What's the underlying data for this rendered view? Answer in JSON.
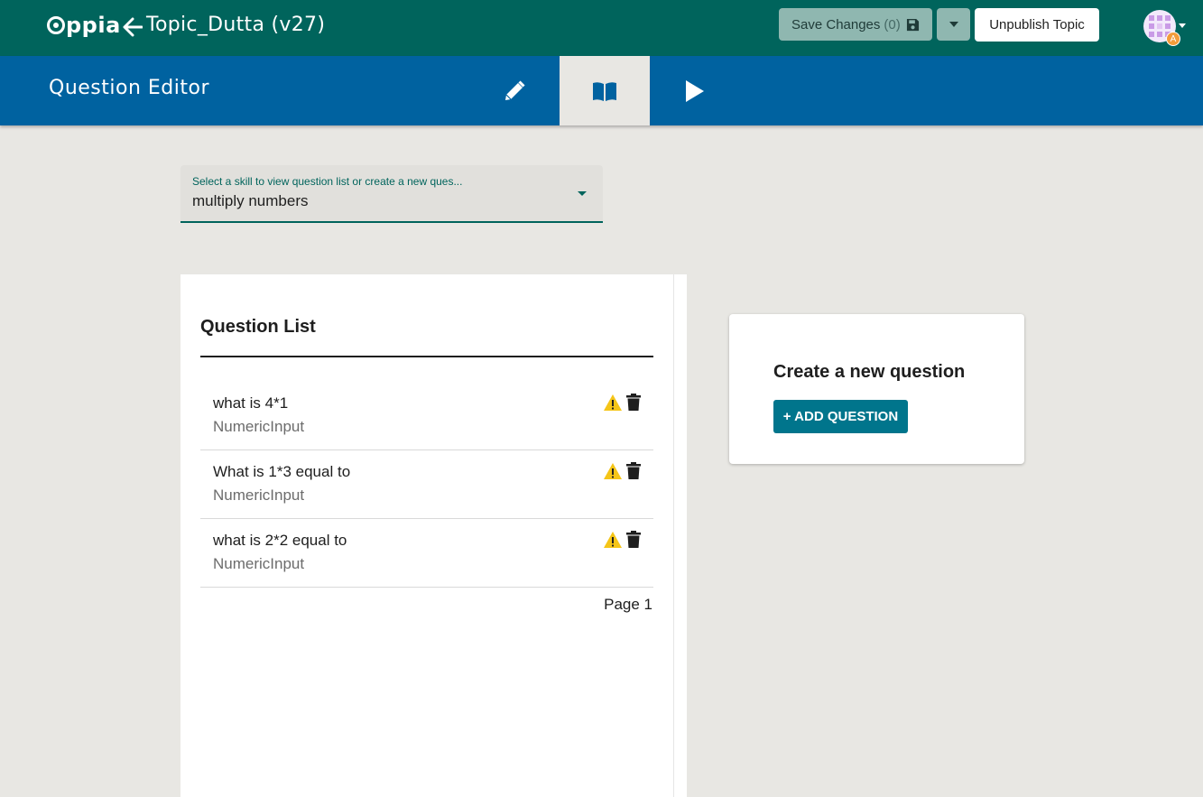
{
  "app": {
    "logo_text": "ppia"
  },
  "topbar": {
    "topic_title": "Topic_Dutta (v27)",
    "save_label": "Save Changes",
    "save_count": "(0)",
    "unpublish_label": "Unpublish Topic",
    "avatar_badge": "A"
  },
  "editor": {
    "title": "Question Editor"
  },
  "skill_selector": {
    "label": "Select a skill to view question list or create a new ques...",
    "value": "multiply numbers"
  },
  "question_list": {
    "title": "Question List",
    "items": [
      {
        "text": "what is 4*1",
        "type": "NumericInput"
      },
      {
        "text": "What is 1*3 equal to",
        "type": "NumericInput"
      },
      {
        "text": "what is 2*2 equal to",
        "type": "NumericInput"
      }
    ],
    "page_label": "Page 1"
  },
  "create_card": {
    "title": "Create a new question",
    "button_label": "+ ADD QUESTION"
  },
  "colors": {
    "topbar": "#00645c",
    "editorbar": "#0062a0",
    "background": "#e8e7e3",
    "add_button": "#00758c",
    "warning": "#f5c518"
  }
}
